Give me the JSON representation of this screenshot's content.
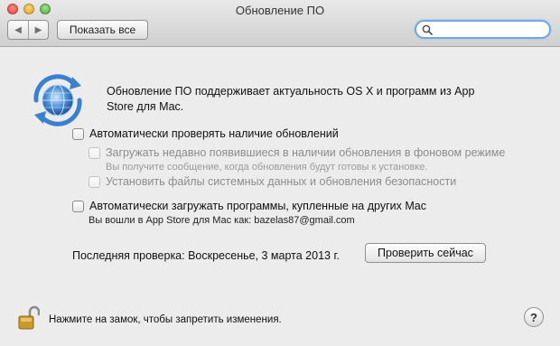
{
  "window": {
    "title": "Обновление ПО",
    "show_all_label": "Показать все",
    "search": {
      "value": "",
      "placeholder": ""
    }
  },
  "main": {
    "description": "Обновление ПО поддерживает актуальность OS X и программ из App Store для Mac.",
    "auto_check": {
      "label": "Автоматически проверять наличие обновлений",
      "checked": false
    },
    "background_download": {
      "label": "Загружать недавно появившиеся в наличии обновления в фоновом режиме",
      "note": "Вы получите сообщение, когда обновления будут готовы к установке.",
      "checked": false,
      "enabled": false
    },
    "system_files": {
      "label": "Установить файлы системных данных и обновления безопасности",
      "checked": false,
      "enabled": false
    },
    "auto_download_apps": {
      "label": "Автоматически загружать программы, купленные на других Mac",
      "note": "Вы вошли в App Store для Mac как: bazelas87@gmail.com",
      "checked": false
    },
    "last_check": "Последняя проверка: Воскресенье, 3 марта 2013 г.",
    "check_now_label": "Проверить сейчас"
  },
  "footer": {
    "lock_text": "Нажмите на замок, чтобы запретить изменения.",
    "help_label": "?"
  },
  "icons": {
    "app": "software-update-icon",
    "lock": "lock-open-icon",
    "search": "magnifier-icon"
  },
  "colors": {
    "accent": "#6fa7e4",
    "window_bg": "#ececec"
  }
}
